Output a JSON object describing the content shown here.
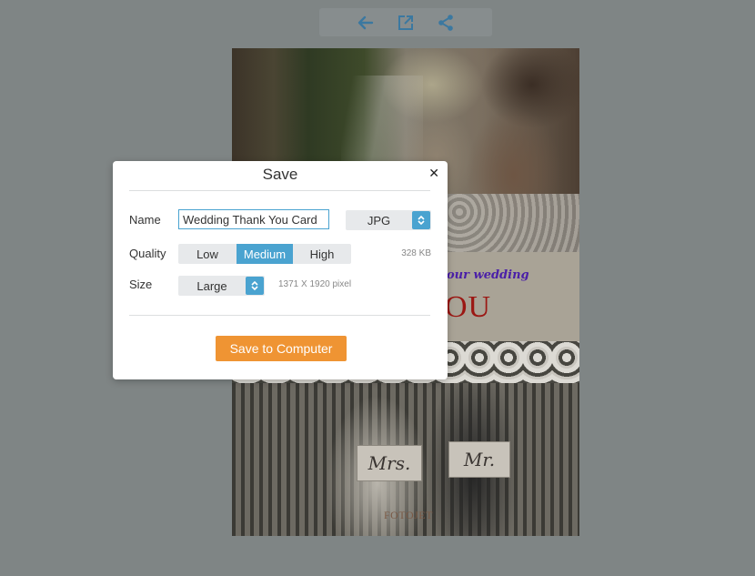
{
  "toolbar": {
    "buttons": [
      {
        "icon": "arrow-left-icon",
        "label": "Back"
      },
      {
        "icon": "open-external-icon",
        "label": "Open"
      },
      {
        "icon": "share-icon",
        "label": "Share"
      }
    ],
    "icon_color": "#3b78a0"
  },
  "card": {
    "banner_subtitle": "our wedding",
    "banner_title": "OU",
    "sign_left": "Mrs.",
    "sign_right": "Mr.",
    "watermark": "FOTOJET"
  },
  "dialog": {
    "title": "Save",
    "close_glyph": "✕",
    "name_label": "Name",
    "name_value": "Wedding Thank You Card",
    "format_value": "JPG",
    "quality_label": "Quality",
    "quality_options": [
      "Low",
      "Medium",
      "High"
    ],
    "quality_selected": "Medium",
    "file_size": "328 KB",
    "size_label": "Size",
    "size_value": "Large",
    "dimensions": "1371 X 1920 pixel",
    "save_button": "Save to Computer"
  },
  "colors": {
    "accent_blue": "#4aa3d0",
    "save_orange": "#ef9433",
    "overlay": "#7f8585"
  }
}
